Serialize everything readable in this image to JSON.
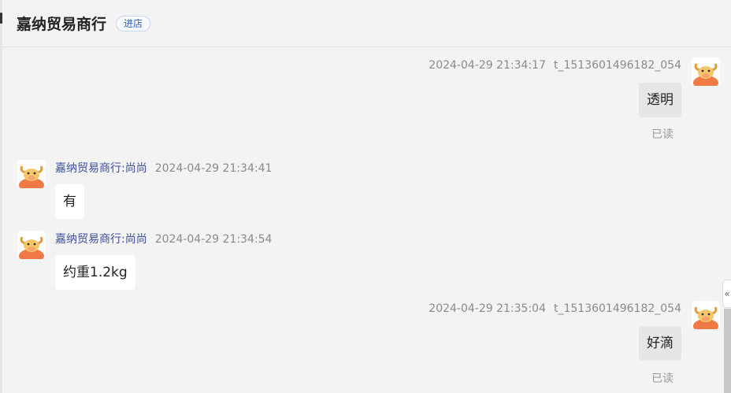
{
  "header": {
    "shop_name": "嘉纳贸易商行",
    "enter_label": "进店"
  },
  "messages": [
    {
      "direction": "out",
      "timestamp": "2024-04-29 21:34:17",
      "user_id": "t_1513601496182_054",
      "text": "透明",
      "status": "已读"
    },
    {
      "direction": "in",
      "sender": "嘉纳贸易商行:尚尚",
      "timestamp": "2024-04-29 21:34:41",
      "text": "有"
    },
    {
      "direction": "in",
      "sender": "嘉纳贸易商行:尚尚",
      "timestamp": "2024-04-29 21:34:54",
      "text": "约重1.2kg"
    },
    {
      "direction": "out",
      "timestamp": "2024-04-29 21:35:04",
      "user_id": "t_1513601496182_054",
      "text": "好滴",
      "status": "已读"
    }
  ],
  "side": {
    "collapse_glyph": "«"
  },
  "colors": {
    "sender_name": "#3d4fa0",
    "enter_button_text": "#2a63c4",
    "background": "#f3f3f3"
  },
  "icons": {
    "avatar": "cartoon-bull-avatar-icon"
  }
}
